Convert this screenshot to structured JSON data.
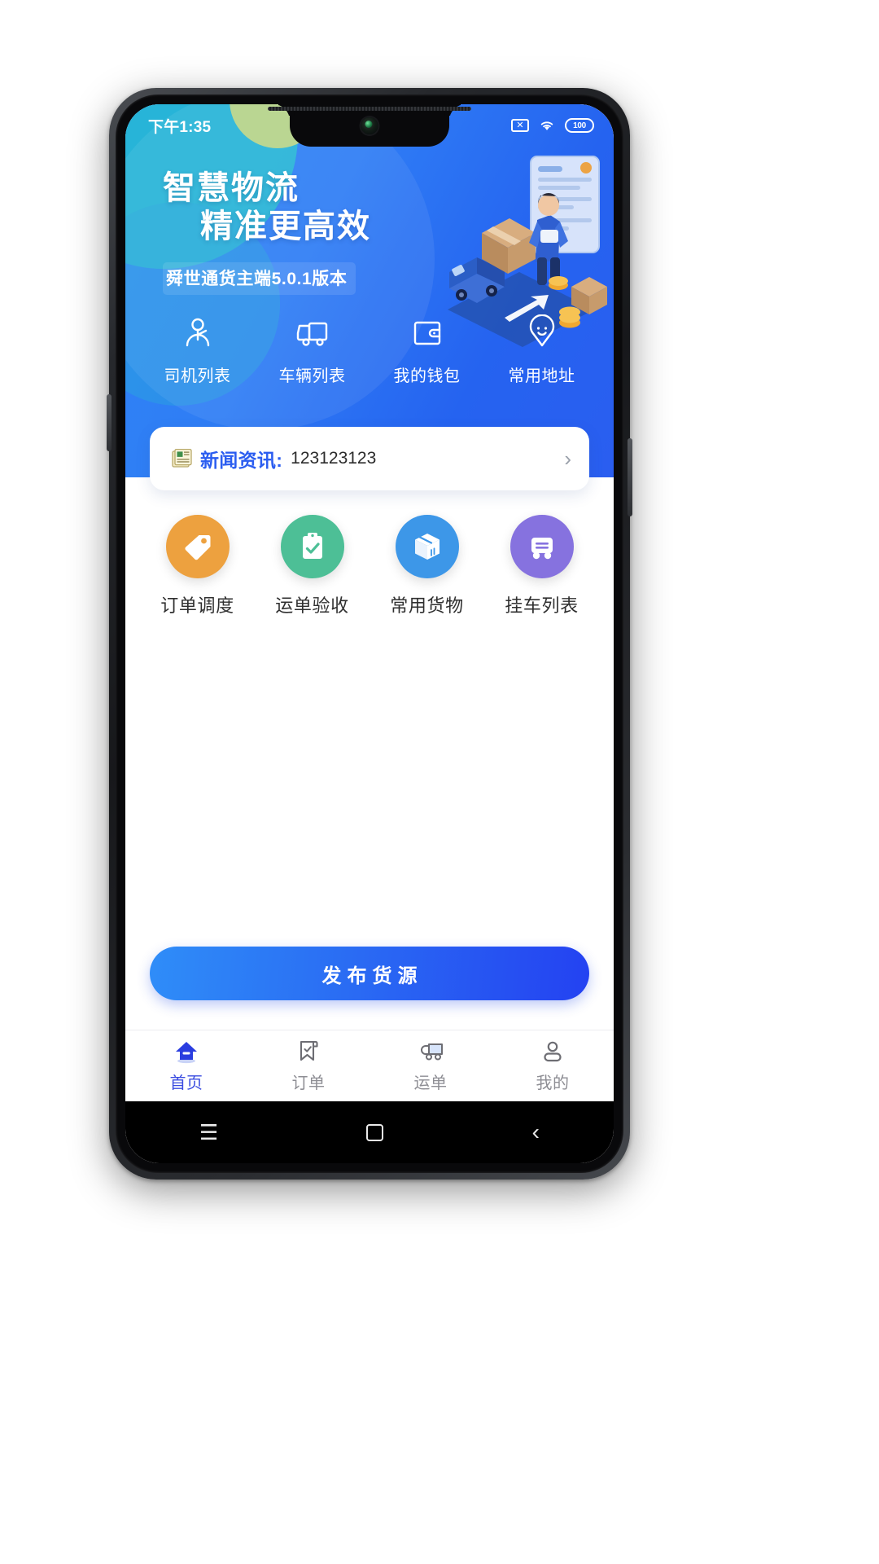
{
  "statusbar": {
    "time": "下午1:35",
    "sim_icon": "sim-off-icon",
    "sim_glyph": "✕",
    "wifi_icon": "wifi-icon",
    "battery_icon": "battery-icon",
    "battery_level": "100"
  },
  "hero": {
    "title_line1": "智慧物流",
    "title_line2": "精准更高效",
    "version": "舜世通货主端5.0.1版本",
    "illustration_name": "logistics-delivery-illustration",
    "bg_color": "#2f7df5",
    "accent_teal": "#27b6d6",
    "accent_lime": "#c9d98a"
  },
  "quick_actions": [
    {
      "label": "司机列表",
      "icon": "driver-person-icon"
    },
    {
      "label": "车辆列表",
      "icon": "truck-icon"
    },
    {
      "label": "我的钱包",
      "icon": "wallet-icon"
    },
    {
      "label": "常用地址",
      "icon": "location-pin-smiley-icon"
    }
  ],
  "news": {
    "icon": "newspaper-icon",
    "label": "新闻资讯:",
    "value": "123123123",
    "chevron": "›",
    "label_color": "#2b5df0"
  },
  "menu_grid": [
    {
      "label": "订单调度",
      "icon": "tag-icon",
      "color": "#eda13f"
    },
    {
      "label": "运单验收",
      "icon": "clipboard-check-icon",
      "color": "#4dbf96"
    },
    {
      "label": "常用货物",
      "icon": "package-box-icon",
      "color": "#3d97e8"
    },
    {
      "label": "挂车列表",
      "icon": "trailer-icon",
      "color": "#8672df"
    }
  ],
  "cta": {
    "label": "发布货源",
    "color": "#2a5ef1"
  },
  "tabbar": {
    "active_color": "#3a4ce0",
    "inactive_color": "#8e8e94",
    "items": [
      {
        "label": "首页",
        "icon": "home-icon",
        "active": true
      },
      {
        "label": "订单",
        "icon": "order-bookmark-icon",
        "active": false
      },
      {
        "label": "运单",
        "icon": "waybill-truck-icon",
        "active": false
      },
      {
        "label": "我的",
        "icon": "profile-person-icon",
        "active": false
      }
    ]
  },
  "androidnav": {
    "recents": "☰",
    "home": "home-square-icon",
    "back": "‹"
  }
}
